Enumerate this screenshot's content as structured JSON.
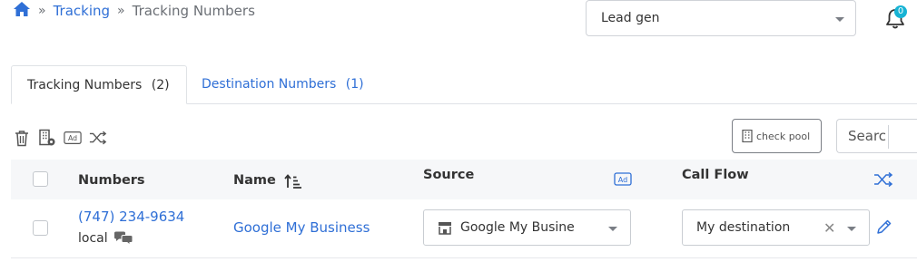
{
  "breadcrumb": {
    "items": [
      "Tracking",
      "Tracking Numbers"
    ]
  },
  "header": {
    "campaign_select_value": "Lead gen",
    "notification_count": "0"
  },
  "tabs": [
    {
      "label": "Tracking Numbers",
      "count": "(2)",
      "active": true
    },
    {
      "label": "Destination Numbers",
      "count": "(1)",
      "active": false
    }
  ],
  "toolbar": {
    "check_pool_label": "check pool",
    "search_placeholder": "Search"
  },
  "table": {
    "columns": [
      "Numbers",
      "Name",
      "Source",
      "Call Flow"
    ],
    "rows": [
      {
        "number": "(747) 234-9634",
        "number_type": "local",
        "name": "Google My Business",
        "source": "Google My Business",
        "call_flow": "My destination"
      }
    ]
  },
  "colors": {
    "link": "#2f6fd6",
    "badge": "#17b3d4",
    "header_bg": "#f6f7f9"
  }
}
